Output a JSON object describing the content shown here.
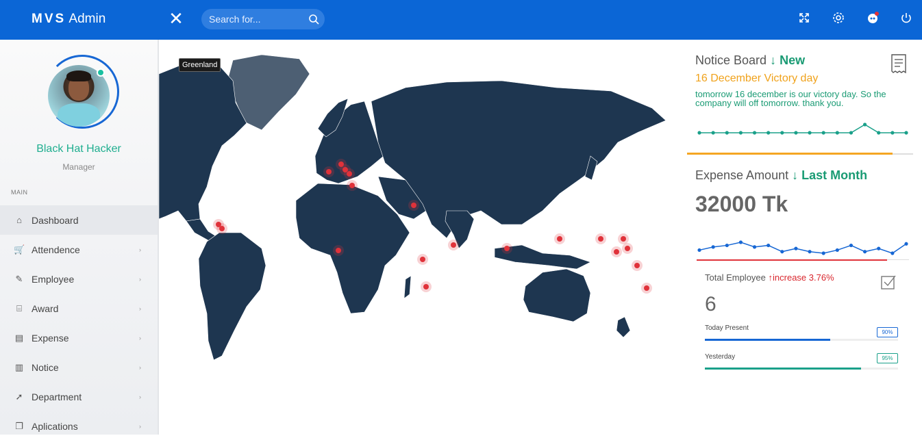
{
  "header": {
    "brand_bold": "MVS",
    "brand_light": "Admin",
    "close_label": "✕",
    "search": {
      "placeholder": "Search for..."
    },
    "icons": [
      "fullscreen-icon",
      "settings-icon",
      "notifications-icon",
      "power-icon"
    ]
  },
  "profile": {
    "name": "Black Hat Hacker",
    "role": "Manager",
    "status": "online"
  },
  "sidebar": {
    "section_label": "MAIN",
    "items": [
      {
        "label": "Dashboard",
        "icon": "home-icon",
        "active": true,
        "has_caret": false
      },
      {
        "label": "Attendence",
        "icon": "cart-icon",
        "active": false,
        "has_caret": true
      },
      {
        "label": "Employee",
        "icon": "brush-icon",
        "active": false,
        "has_caret": true
      },
      {
        "label": "Award",
        "icon": "briefcase-icon",
        "active": false,
        "has_caret": true
      },
      {
        "label": "Expense",
        "icon": "document-icon",
        "active": false,
        "has_caret": true
      },
      {
        "label": "Notice",
        "icon": "books-icon",
        "active": false,
        "has_caret": true
      },
      {
        "label": "Department",
        "icon": "cursor-icon",
        "active": false,
        "has_caret": true
      },
      {
        "label": "Aplications",
        "icon": "copy-icon",
        "active": false,
        "has_caret": true
      }
    ]
  },
  "map": {
    "tooltip": "Greenland",
    "land_color": "#1e3650",
    "highlight_color": "#4d5f73",
    "marker_color": "#e0323a"
  },
  "notice_board": {
    "title": "Notice Board",
    "arrow": "↓",
    "tag": "New",
    "subtitle": "16 December Victory day",
    "body": "tomorrow 16 december is our victory day. So the company will off tomorrow. thank you.",
    "sparkline": [
      5,
      5,
      5,
      5,
      5,
      5,
      5,
      5,
      5,
      5,
      5,
      5,
      6,
      5,
      5,
      5
    ]
  },
  "expense": {
    "title": "Expense Amount",
    "arrow": "↓",
    "period": "Last Month",
    "amount": "32000 Tk",
    "sparkline": [
      3,
      5,
      6,
      8,
      5,
      6,
      2,
      4,
      2,
      1,
      3,
      6,
      2,
      4,
      1,
      7
    ]
  },
  "employees": {
    "title": "Total Employee",
    "arrow": "↑",
    "change": "increase 3.76%",
    "count": "6",
    "progress": [
      {
        "label": "Today Present",
        "percent_text": "90%",
        "value": 0.65,
        "color": "#1767d4"
      },
      {
        "label": "Yesterday",
        "percent_text": "95%",
        "value": 0.81,
        "color": "#1aa08a"
      }
    ]
  }
}
